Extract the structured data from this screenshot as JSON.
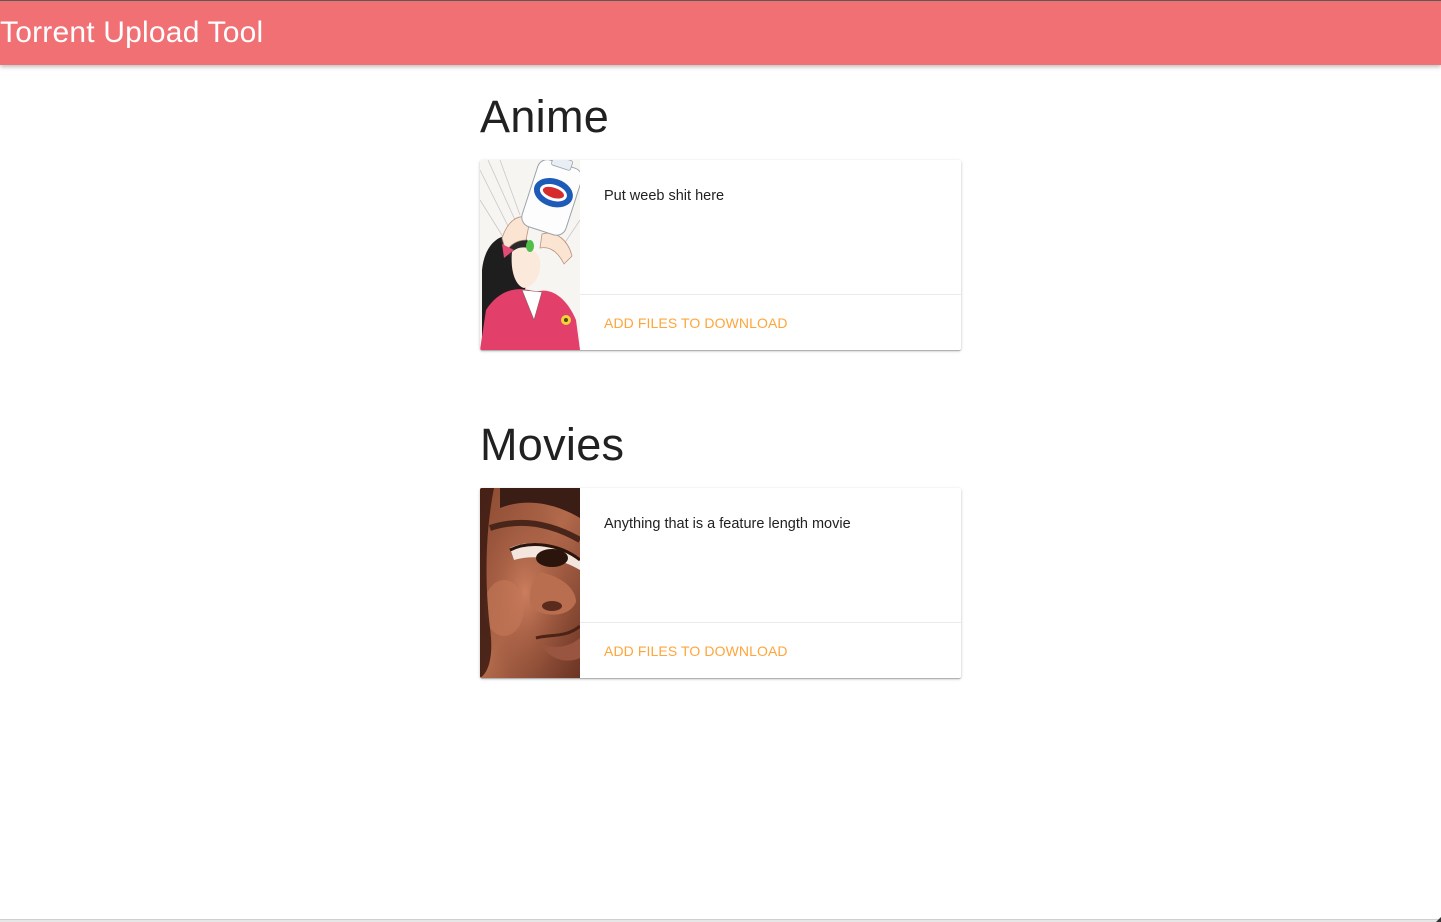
{
  "app": {
    "title": "Torrent Upload Tool",
    "accent_color": "#f07074",
    "action_color": "#ffa53a"
  },
  "sections": [
    {
      "title": "Anime",
      "card": {
        "image": "anime-girl-drinking-bleach-image",
        "description": "Put weeb shit here",
        "action_label": "Add files to download"
      }
    },
    {
      "title": "Movies",
      "card": {
        "image": "animated-face-closeup-image",
        "description": "Anything that is a feature length movie",
        "action_label": "Add files to download"
      }
    }
  ]
}
